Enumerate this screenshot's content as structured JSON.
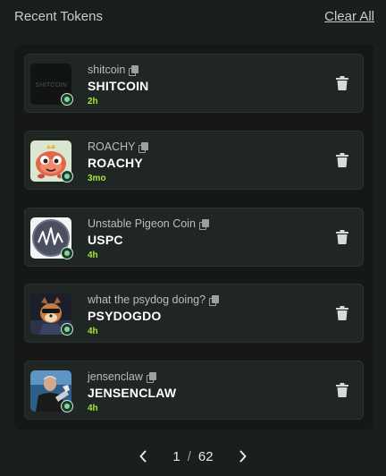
{
  "header": {
    "title": "Recent Tokens",
    "clear_all": "Clear All"
  },
  "tokens": [
    {
      "name": "shitcoin",
      "symbol": "SHITCOIN",
      "age": "2h",
      "thumb_text": "SHITCOIN"
    },
    {
      "name": "ROACHY",
      "symbol": "ROACHY",
      "age": "3mo"
    },
    {
      "name": "Unstable Pigeon Coin",
      "symbol": "USPC",
      "age": "4h"
    },
    {
      "name": "what the psydog doing?",
      "symbol": "PSYDOGDO",
      "age": "4h"
    },
    {
      "name": "jensenclaw",
      "symbol": "JENSENCLAW",
      "age": "4h"
    }
  ],
  "pagination": {
    "current": "1",
    "separator": "/",
    "total": "62"
  },
  "colors": {
    "age_green": "#a3e635",
    "card_bg": "#1f2624",
    "page_bg": "#1a1e1d"
  }
}
